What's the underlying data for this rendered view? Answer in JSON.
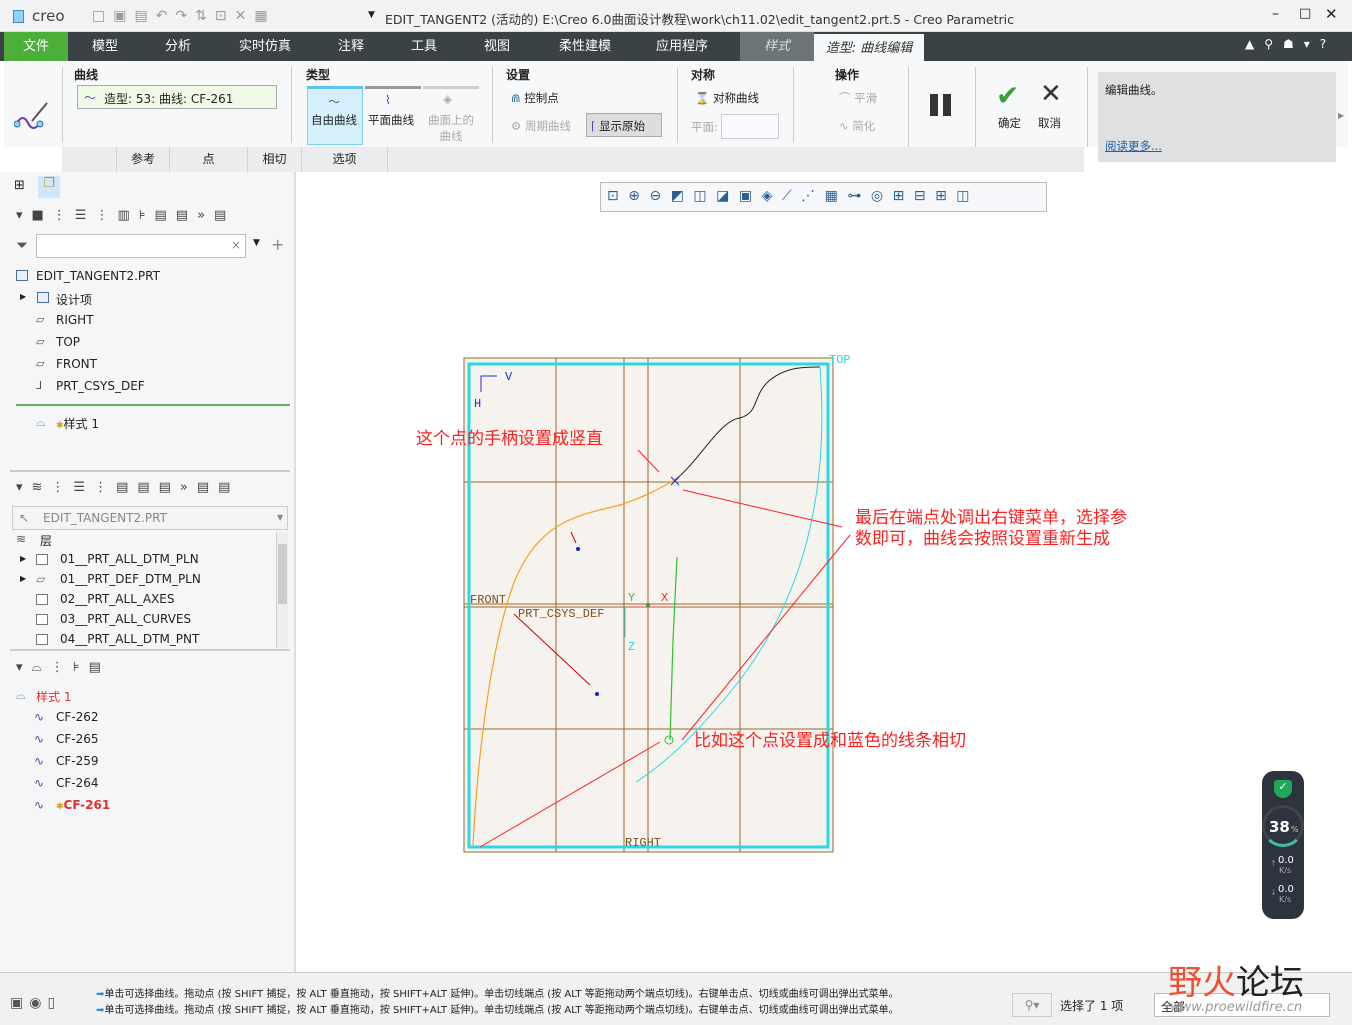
{
  "app": {
    "logo": "creo",
    "title": "EDIT_TANGENT2 (活动的) E:\\Creo 6.0曲面设计教程\\work\\ch11.02\\edit_tangent2.prt.5 - Creo Parametric"
  },
  "menu": [
    {
      "label": "文件"
    },
    {
      "label": "模型"
    },
    {
      "label": "分析"
    },
    {
      "label": "实时仿真"
    },
    {
      "label": "注释"
    },
    {
      "label": "工具"
    },
    {
      "label": "视图"
    },
    {
      "label": "柔性建模"
    },
    {
      "label": "应用程序"
    },
    {
      "label": "样式"
    },
    {
      "label": "造型: 曲线编辑"
    }
  ],
  "ribbon": {
    "curve_group": "曲线",
    "curve_field": "造型: 53: 曲线: CF-261",
    "type_group": "类型",
    "free_curve": "自由曲线",
    "plane_curve": "平面曲线",
    "surface_curve": "曲面上的曲线",
    "settings_group": "设置",
    "control_points": "控制点",
    "periodic": "周期曲线",
    "show_original": "显示原始",
    "symmetry_group": "对称",
    "sym_curve": "对称曲线",
    "plane_label": "平面:",
    "plane_value": "",
    "ops_group": "操作",
    "smooth": "平滑",
    "simplify": "简化",
    "ok": "确定",
    "cancel": "取消",
    "help_text": "编辑曲线。",
    "read_more": "阅读更多..."
  },
  "subtabs": [
    "参考",
    "点",
    "相切",
    "选项"
  ],
  "model_tree": {
    "search_placeholder": "",
    "root": "EDIT_TANGENT2.PRT",
    "items": [
      "设计项",
      "RIGHT",
      "TOP",
      "FRONT",
      "PRT_CSYS_DEF"
    ],
    "style": "样式 1"
  },
  "layer_tree": {
    "selector": "EDIT_TANGENT2.PRT",
    "header": "层",
    "items": [
      "01__PRT_ALL_DTM_PLN",
      "01__PRT_DEF_DTM_PLN",
      "02__PRT_ALL_AXES",
      "03__PRT_ALL_CURVES",
      "04__PRT_ALL_DTM_PNT"
    ]
  },
  "style_tree": {
    "root": "样式 1",
    "items": [
      "CF-262",
      "CF-265",
      "CF-259",
      "CF-264",
      "CF-261"
    ],
    "active": "CF-261"
  },
  "viewport": {
    "labels": {
      "top": "TOP",
      "front": "FRONT",
      "right": "RIGHT",
      "csys": "PRT_CSYS_DEF",
      "x": "X",
      "y": "Y",
      "z": "Z",
      "h": "H",
      "v": "V"
    },
    "annotations": [
      "这个点的手柄设置成竖直",
      "最后在端点处调出右键菜单，选择参",
      "数即可，曲线会按照设置重新生成",
      "比如这个点设置成和蓝色的线条相切"
    ]
  },
  "net_widget": {
    "percent": "38",
    "unit": "%",
    "up": "0.0",
    "down": "0.0",
    "rate_unit": "K/s"
  },
  "status": {
    "line1": "单击可选择曲线。拖动点 (按 SHIFT 捕捉，按 ALT 垂直拖动，按 SHIFT+ALT 延伸)。单击切线端点 (按 ALT 等距拖动两个端点切线)。右键单击点、切线或曲线可调出弹出式菜单。",
    "line2": "单击可选择曲线。拖动点 (按 SHIFT 捕捉，按 ALT 垂直拖动，按 SHIFT+ALT 延伸)。单击切线端点 (按 ALT 等距拖动两个端点切线)。右键单击点、切线或曲线可调出弹出式菜单。",
    "selected": "选择了 1 项",
    "filter": "全部"
  },
  "watermark": {
    "text": "野火论坛",
    "url": "www.proewildfire.cn"
  },
  "colors": {
    "menubar": "#3a4245",
    "file_tab": "#4caf3a",
    "accent": "#2ad8e0",
    "annotation": "#ff2020"
  }
}
